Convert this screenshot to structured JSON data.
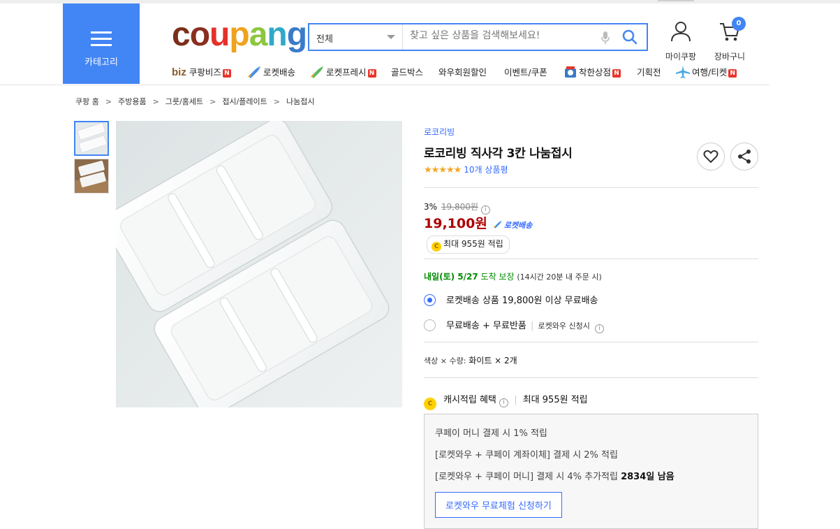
{
  "header": {
    "category_label": "카테고리",
    "logo_text": "coupang",
    "search": {
      "scope": "전체",
      "placeholder": "찾고 싶은 상품을 검색해보세요!"
    },
    "my_coupang": "마이쿠팡",
    "cart": {
      "label": "장바구니",
      "count": "0"
    },
    "nav": [
      {
        "prefix": "biz",
        "label": "쿠팡비즈",
        "new": "N"
      },
      {
        "label": "로켓배송",
        "icon": "rocket-icon"
      },
      {
        "label": "로켓프레시",
        "icon": "rocket-icon",
        "new": "N"
      },
      {
        "label": "골드박스"
      },
      {
        "label": "와우회원할인"
      },
      {
        "label": "이벤트/쿠폰"
      },
      {
        "label": "착한상점",
        "icon": "shop-icon",
        "new": "N"
      },
      {
        "label": "기획전"
      },
      {
        "label": "여행/티켓",
        "icon": "airplane-icon",
        "new": "N"
      }
    ]
  },
  "breadcrumb": [
    "쿠팡 홈",
    "주방용품",
    "그릇/홈세트",
    "접시/플레이트",
    "나눔접시"
  ],
  "product": {
    "brand": "로코리빙",
    "title": "로코리빙 직사각 3칸 나눔접시",
    "stars": "★★★★★",
    "rating_count": 5,
    "review_text": "10개 상품평",
    "discount": "3%",
    "original_price": "19,800원",
    "price": "19,100원",
    "rocket_badge": "로켓배송",
    "cash_badge": "최대 955원 적립",
    "delivery": {
      "date": "내일(토) 5/27",
      "suffix": "도착 보장",
      "note": "(14시간 20분 내 주문 시)"
    },
    "options": [
      {
        "label": "로켓배송 상품 19,800원 이상 무료배송",
        "selected": true
      },
      {
        "label": "무료배송 + 무료반품",
        "extra": "로켓와우 신청시",
        "selected": false
      }
    ],
    "variant": {
      "label": "색상 × 수량:",
      "value": "화이트 × 2개"
    },
    "cashback": {
      "label": "캐시적립 혜택",
      "value_prefix": "최대",
      "value": "955원",
      "value_suffix": "적립"
    },
    "benefits": [
      "쿠페이 머니 결제 시 1% 적립",
      "[로켓와우 + 쿠페이 계좌이체] 결제 시 2% 적립",
      "[로켓와우 + 쿠페이 머니] 결제 시 4% 추가적립"
    ],
    "benefit_days_left": "2834일 남음",
    "trial_button": "로켓와우 무료체험 신청하기"
  },
  "colors": {
    "accent": "#4285f4",
    "link": "#346aff",
    "price": "#ae0000",
    "delivery_green": "#008c00",
    "badge_red": "#e8352b",
    "star": "#f5a623"
  }
}
